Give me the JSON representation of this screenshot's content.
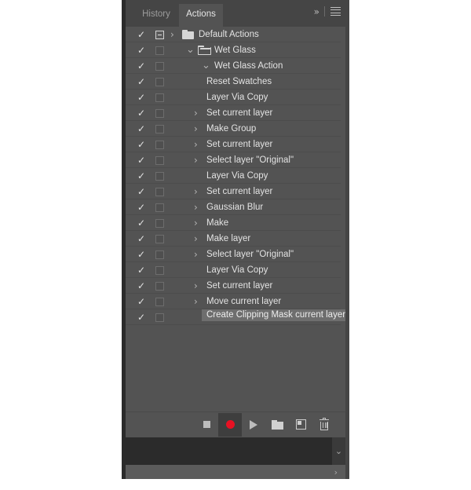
{
  "panel": {
    "tabs": [
      {
        "label": "History",
        "active": false
      },
      {
        "label": "Actions",
        "active": true
      }
    ],
    "header_icons": {
      "collapse": "»",
      "menu": "panel-menu-icon"
    },
    "colors": {
      "panel_bg": "#535353",
      "tabbar_bg": "#454545",
      "row_separator": "#4c4c4c",
      "selected_row": "#6e6e6e",
      "record_red": "#e81123",
      "text": "#e3e3e3"
    },
    "rows": [
      {
        "label": "Default Actions",
        "checked": true,
        "modal": "dash",
        "arrow": "right",
        "folder": "closed",
        "level": 0
      },
      {
        "label": "Wet Glass",
        "checked": true,
        "modal": "empty",
        "arrow": "down",
        "folder": "open",
        "level": 1
      },
      {
        "label": "Wet Glass Action",
        "checked": true,
        "modal": "empty",
        "arrow": "down",
        "folder": "none",
        "level": 2
      },
      {
        "label": "Reset Swatches",
        "checked": true,
        "modal": "empty",
        "arrow": "none",
        "folder": "none",
        "level": 3
      },
      {
        "label": "Layer Via Copy",
        "checked": true,
        "modal": "empty",
        "arrow": "none",
        "folder": "none",
        "level": 3
      },
      {
        "label": "Set current layer",
        "checked": true,
        "modal": "empty",
        "arrow": "right",
        "folder": "none",
        "level": 3
      },
      {
        "label": "Make Group",
        "checked": true,
        "modal": "empty",
        "arrow": "right",
        "folder": "none",
        "level": 3
      },
      {
        "label": "Set current layer",
        "checked": true,
        "modal": "empty",
        "arrow": "right",
        "folder": "none",
        "level": 3
      },
      {
        "label": "Select layer \"Original\"",
        "checked": true,
        "modal": "empty",
        "arrow": "right",
        "folder": "none",
        "level": 3
      },
      {
        "label": "Layer Via Copy",
        "checked": true,
        "modal": "empty",
        "arrow": "none",
        "folder": "none",
        "level": 3
      },
      {
        "label": "Set current layer",
        "checked": true,
        "modal": "empty",
        "arrow": "right",
        "folder": "none",
        "level": 3
      },
      {
        "label": "Gaussian Blur",
        "checked": true,
        "modal": "empty",
        "arrow": "right",
        "folder": "none",
        "level": 3
      },
      {
        "label": "Make",
        "checked": true,
        "modal": "empty",
        "arrow": "right",
        "folder": "none",
        "level": 3
      },
      {
        "label": "Make layer",
        "checked": true,
        "modal": "empty",
        "arrow": "right",
        "folder": "none",
        "level": 3
      },
      {
        "label": "Select layer \"Original\"",
        "checked": true,
        "modal": "empty",
        "arrow": "right",
        "folder": "none",
        "level": 3
      },
      {
        "label": "Layer Via Copy",
        "checked": true,
        "modal": "empty",
        "arrow": "none",
        "folder": "none",
        "level": 3
      },
      {
        "label": "Set current layer",
        "checked": true,
        "modal": "empty",
        "arrow": "right",
        "folder": "none",
        "level": 3
      },
      {
        "label": "Move current layer",
        "checked": true,
        "modal": "empty",
        "arrow": "right",
        "folder": "none",
        "level": 3
      },
      {
        "label": "Create Clipping Mask current layer",
        "checked": true,
        "modal": "empty",
        "arrow": "none",
        "folder": "none",
        "level": 3,
        "selected": true
      }
    ],
    "toolbar": [
      {
        "name": "stop-button",
        "glyph": "stop",
        "active": false
      },
      {
        "name": "record-button",
        "glyph": "record",
        "active": true
      },
      {
        "name": "play-button",
        "glyph": "play",
        "active": false
      },
      {
        "name": "new-set-button",
        "glyph": "folder",
        "active": false
      },
      {
        "name": "new-action-button",
        "glyph": "newdoc",
        "active": false
      },
      {
        "name": "delete-button",
        "glyph": "trash",
        "active": false
      }
    ],
    "dock": {
      "expand_down": "⌄",
      "expand_right": "›"
    }
  }
}
